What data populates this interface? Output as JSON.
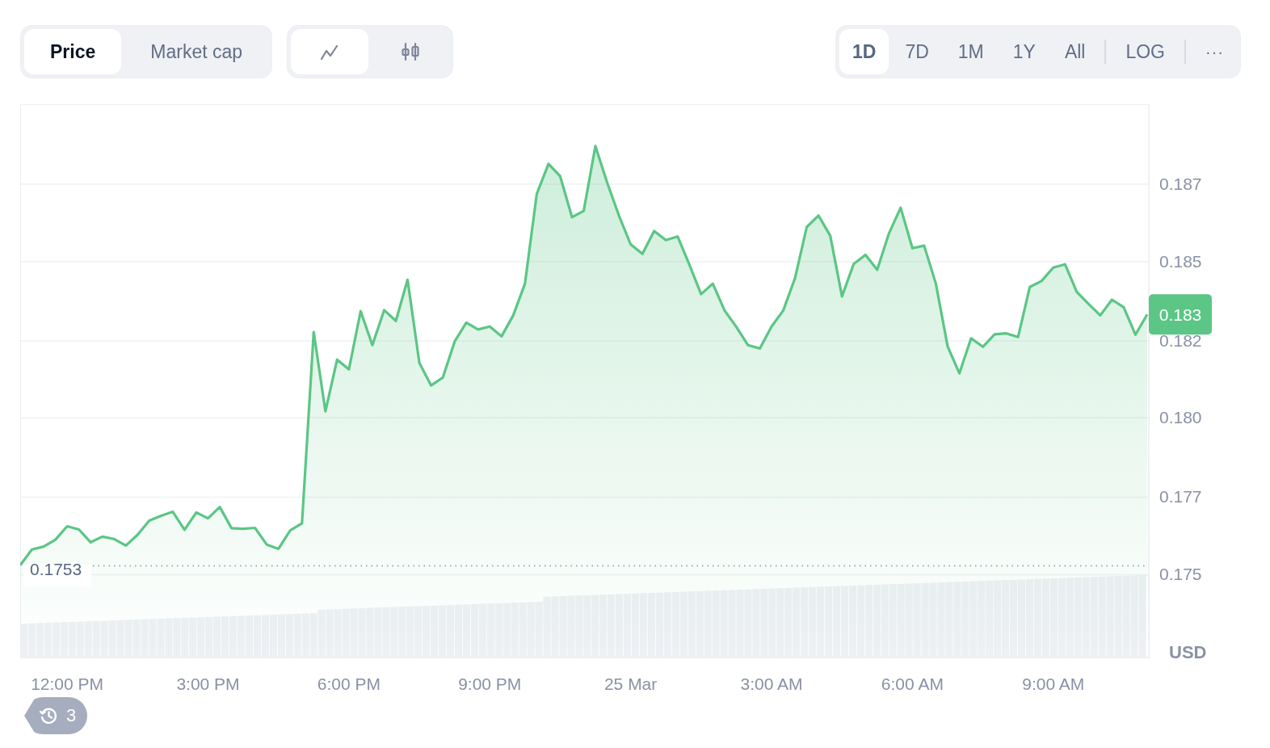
{
  "view_tabs": [
    {
      "label": "Price",
      "selected": true
    },
    {
      "label": "Market cap",
      "selected": false
    }
  ],
  "chart_types": [
    {
      "kind": "line",
      "selected": true
    },
    {
      "kind": "candle",
      "selected": false
    }
  ],
  "ranges": [
    {
      "label": "1D",
      "selected": true
    },
    {
      "label": "7D",
      "selected": false
    },
    {
      "label": "1M",
      "selected": false
    },
    {
      "label": "1Y",
      "selected": false
    },
    {
      "label": "All",
      "selected": false
    }
  ],
  "log_toggle": {
    "label": "LOG",
    "on": false
  },
  "more_button": {
    "label": "···"
  },
  "chart": {
    "chart_data": {
      "type": "area",
      "ylabel": "USD",
      "ylim": [
        0.1725,
        0.1894
      ],
      "yticks": [
        {
          "value": 0.17503,
          "label": "0.175"
        },
        {
          "value": 0.1774,
          "label": "0.177"
        },
        {
          "value": 0.17982,
          "label": "0.180"
        },
        {
          "value": 0.18217,
          "label": "0.182"
        },
        {
          "value": 0.18459,
          "label": "0.185"
        },
        {
          "value": 0.18696,
          "label": "0.187"
        }
      ],
      "categories": [
        null,
        null,
        null,
        null,
        "12:00 PM",
        null,
        null,
        null,
        null,
        null,
        null,
        null,
        null,
        null,
        null,
        null,
        "3:00 PM",
        null,
        null,
        null,
        null,
        null,
        null,
        null,
        null,
        null,
        null,
        null,
        "6:00 PM",
        null,
        null,
        null,
        null,
        null,
        null,
        null,
        null,
        null,
        null,
        null,
        "9:00 PM",
        null,
        null,
        null,
        null,
        null,
        null,
        null,
        null,
        null,
        null,
        null,
        "25 Mar",
        null,
        null,
        null,
        null,
        null,
        null,
        null,
        null,
        null,
        null,
        null,
        "3:00 AM",
        null,
        null,
        null,
        null,
        null,
        null,
        null,
        null,
        null,
        null,
        null,
        "6:00 AM",
        null,
        null,
        null,
        null,
        null,
        null,
        null,
        null,
        null,
        null,
        null,
        "9:00 AM",
        null,
        null,
        null,
        null,
        null,
        null,
        null,
        null
      ],
      "series": [
        {
          "color": "#5bc685",
          "values": [
            0.17532,
            0.1758,
            0.17589,
            0.1761,
            0.17651,
            0.17641,
            0.17602,
            0.17619,
            0.17612,
            0.17592,
            0.17625,
            0.17668,
            0.17683,
            0.17695,
            0.1764,
            0.17693,
            0.17675,
            0.1771,
            0.17645,
            0.17643,
            0.17646,
            0.17595,
            0.17582,
            0.17638,
            0.1766,
            0.18244,
            0.18002,
            0.1816,
            0.1813,
            0.18308,
            0.18204,
            0.18311,
            0.18278,
            0.18404,
            0.1815,
            0.18081,
            0.18105,
            0.18215,
            0.18273,
            0.18252,
            0.18261,
            0.18231,
            0.18295,
            0.18392,
            0.18666,
            0.18758,
            0.1872,
            0.18595,
            0.18614,
            0.18812,
            0.187,
            0.186,
            0.18512,
            0.18483,
            0.18553,
            0.18525,
            0.18536,
            0.1845,
            0.1836,
            0.18392,
            0.1831,
            0.1826,
            0.18204,
            0.18194,
            0.18261,
            0.1831,
            0.18409,
            0.18565,
            0.186,
            0.18538,
            0.18353,
            0.18452,
            0.1848,
            0.18434,
            0.18545,
            0.18624,
            0.185,
            0.18508,
            0.18392,
            0.182,
            0.18118,
            0.18225,
            0.18199,
            0.18237,
            0.1824,
            0.18229,
            0.18382,
            0.184,
            0.18441,
            0.18451,
            0.18367,
            0.1833,
            0.18295,
            0.18343,
            0.1832,
            0.18236,
            0.18298
          ]
        }
      ],
      "ref_lines": [
        {
          "axis": "y",
          "value": 0.1753,
          "label": "0.1753"
        }
      ],
      "grid": true,
      "annotations": [
        "0.183"
      ]
    }
  },
  "history_badge": {
    "count": "3"
  }
}
